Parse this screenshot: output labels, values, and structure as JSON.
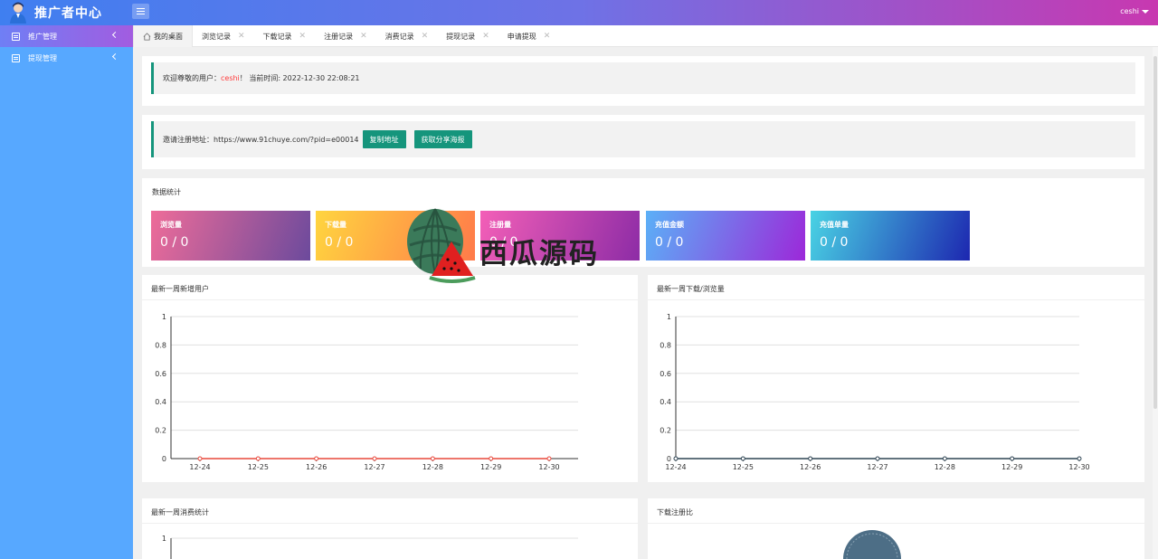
{
  "header": {
    "brand": "推广者中心",
    "username": "ceshi"
  },
  "sidebar": {
    "items": [
      {
        "label": "推广管理",
        "icon": "document-icon",
        "active": true
      },
      {
        "label": "提现管理",
        "icon": "document-icon",
        "active": false
      }
    ]
  },
  "tabs": [
    {
      "label": "我的桌面",
      "active": true,
      "closable": false
    },
    {
      "label": "浏览记录",
      "active": false,
      "closable": true
    },
    {
      "label": "下载记录",
      "active": false,
      "closable": true
    },
    {
      "label": "注册记录",
      "active": false,
      "closable": true
    },
    {
      "label": "消费记录",
      "active": false,
      "closable": true
    },
    {
      "label": "提现记录",
      "active": false,
      "closable": true
    },
    {
      "label": "申请提现",
      "active": false,
      "closable": true
    }
  ],
  "welcome": {
    "prefix": "欢迎尊敬的用户：",
    "user": "ceshi",
    "suffix": "！ 当前时间: 2022-12-30 22:08:21"
  },
  "invite": {
    "text": "邀请注册地址：https://www.91chuye.com/?pid=e00014",
    "copy_button": "复制地址",
    "poster_button": "获取分享海报"
  },
  "stats": {
    "title": "数据统计",
    "cards": [
      {
        "label": "浏览量",
        "value": "0 / 0",
        "gradient": "linear-gradient(110deg,#ee6c99,#6c4a9c)"
      },
      {
        "label": "下载量",
        "value": "0 / 0",
        "gradient": "linear-gradient(110deg,#ffd53f,#ff7a4a)"
      },
      {
        "label": "注册量",
        "value": "0 / 0",
        "gradient": "linear-gradient(110deg,#f35fb7,#8d2ca6)"
      },
      {
        "label": "充值金额",
        "value": "0 / 0",
        "gradient": "linear-gradient(110deg,#5bb0f7,#9c28d9)"
      },
      {
        "label": "充值单量",
        "value": "0 / 0",
        "gradient": "linear-gradient(110deg,#49d3e4,#1d27b0)"
      }
    ]
  },
  "charts": {
    "new_users_title": "最新一周新增用户",
    "downloads_title": "最新一周下载/浏览量",
    "consumption_title": "最新一周消费统计",
    "ratio_title": "下载注册比"
  },
  "chart_data": [
    {
      "type": "line",
      "title": "最新一周新增用户",
      "x": [
        "12-24",
        "12-25",
        "12-26",
        "12-27",
        "12-28",
        "12-29",
        "12-30"
      ],
      "series": [
        {
          "values": [
            0,
            0,
            0,
            0,
            0,
            0,
            0
          ],
          "color": "#e8483c"
        }
      ],
      "yticks": [
        "0",
        "0.2",
        "0.4",
        "0.6",
        "0.8",
        "1"
      ],
      "ylim": [
        0,
        1
      ],
      "grid": true
    },
    {
      "type": "line",
      "title": "最新一周下载/浏览量",
      "x": [
        "12-24",
        "12-25",
        "12-26",
        "12-27",
        "12-28",
        "12-29",
        "12-30"
      ],
      "series": [
        {
          "values": [
            0,
            0,
            0,
            0,
            0,
            0,
            0
          ],
          "color": "#2f4554"
        }
      ],
      "yticks": [
        "0",
        "0.2",
        "0.4",
        "0.6",
        "0.8",
        "1"
      ],
      "ylim": [
        0,
        1
      ],
      "grid": true
    },
    {
      "type": "line",
      "title": "最新一周消费统计",
      "yticks": [
        "1"
      ],
      "ylim": [
        0,
        1
      ],
      "grid": true
    }
  ],
  "watermark": {
    "text": "西瓜源码"
  },
  "colors": {
    "accent": "#15957c",
    "sidebar": "#57a8ff",
    "highlight": "#ff3b3b"
  }
}
